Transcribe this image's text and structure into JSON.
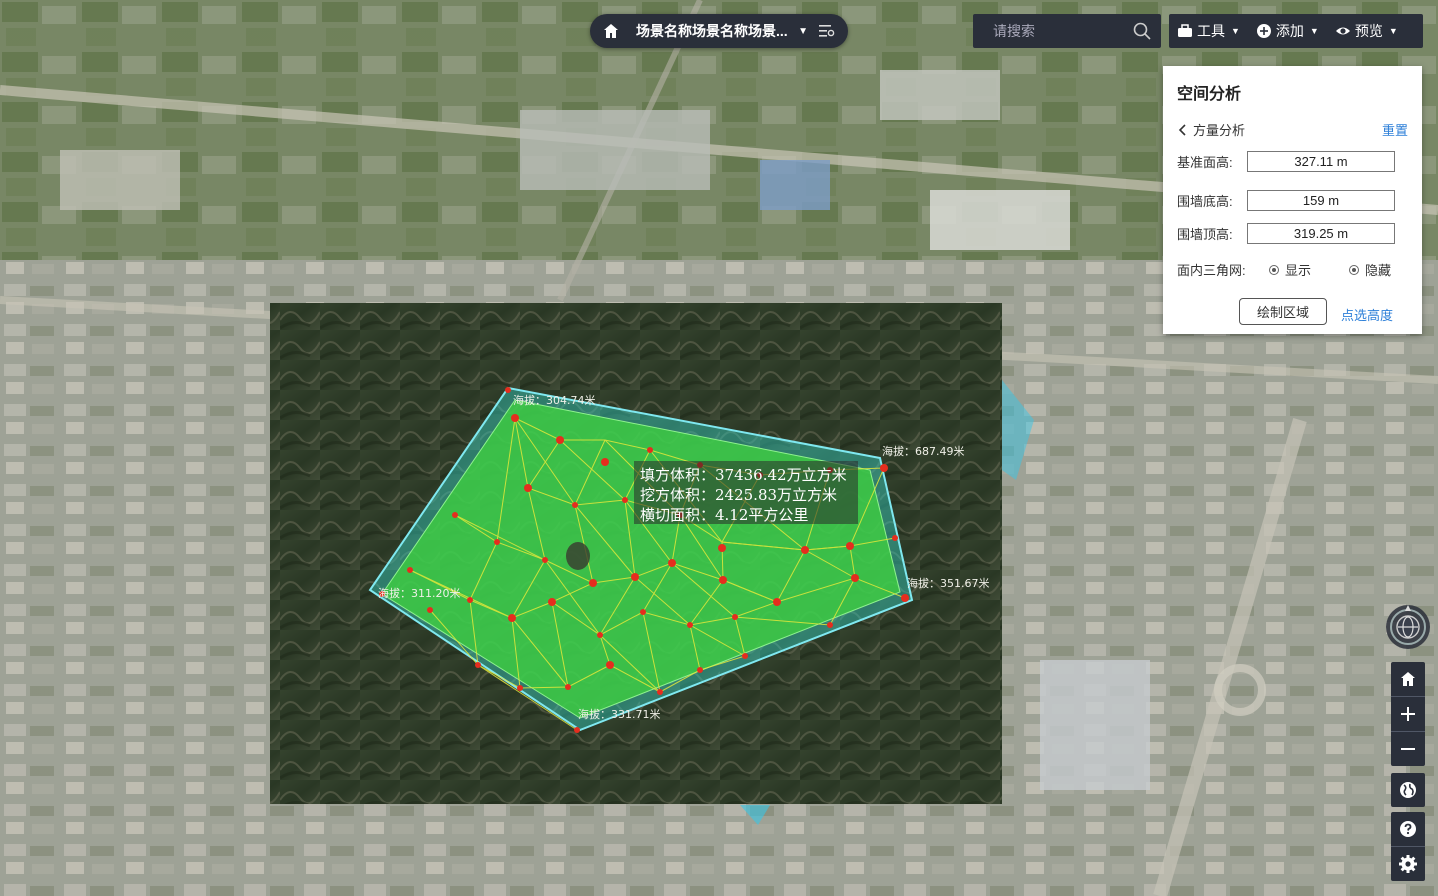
{
  "scene": {
    "title": "场景名称场景名称场景..."
  },
  "search": {
    "placeholder": "请搜索"
  },
  "toolbar": {
    "tools": "工具",
    "add": "添加",
    "preview": "预览"
  },
  "panel": {
    "title": "空间分析",
    "subtitle": "方量分析",
    "reset": "重置",
    "base_height_label": "基准面高:",
    "base_height_value": "327.11 m",
    "wall_bottom_label": "围墙底高:",
    "wall_bottom_value": "159 m",
    "wall_top_label": "围墙顶高:",
    "wall_top_value": "319.25 m",
    "triangle_label": "面内三角网:",
    "show_label": "显示",
    "hide_label": "隐藏",
    "draw_button": "绘制区域",
    "pick_height": "点选高度"
  },
  "analysis": {
    "fill_volume": "填方体积：37436.42万立方米",
    "cut_volume": "挖方体积：2425.83万立方米",
    "cross_area": "横切面积：4.12平方公里",
    "elevations": [
      "海拔：304.74米",
      "海拔：687.49米",
      "海拔：311.20米",
      "海拔：351.67米",
      "海拔：331.71米"
    ]
  },
  "colors": {
    "accent": "#2d7fd8",
    "dark_bar": "#2a2f3a",
    "polygon_fill": "#3fd13f",
    "wall": "#39c6d6"
  },
  "icons": [
    "home-icon",
    "chevron-down-icon",
    "list-settings-icon",
    "search-icon",
    "toolbox-icon",
    "plus-circle-icon",
    "eye-icon",
    "chevron-left-icon",
    "compass-icon",
    "zoom-in-icon",
    "zoom-out-icon",
    "globe-icon",
    "help-icon",
    "gear-icon"
  ]
}
